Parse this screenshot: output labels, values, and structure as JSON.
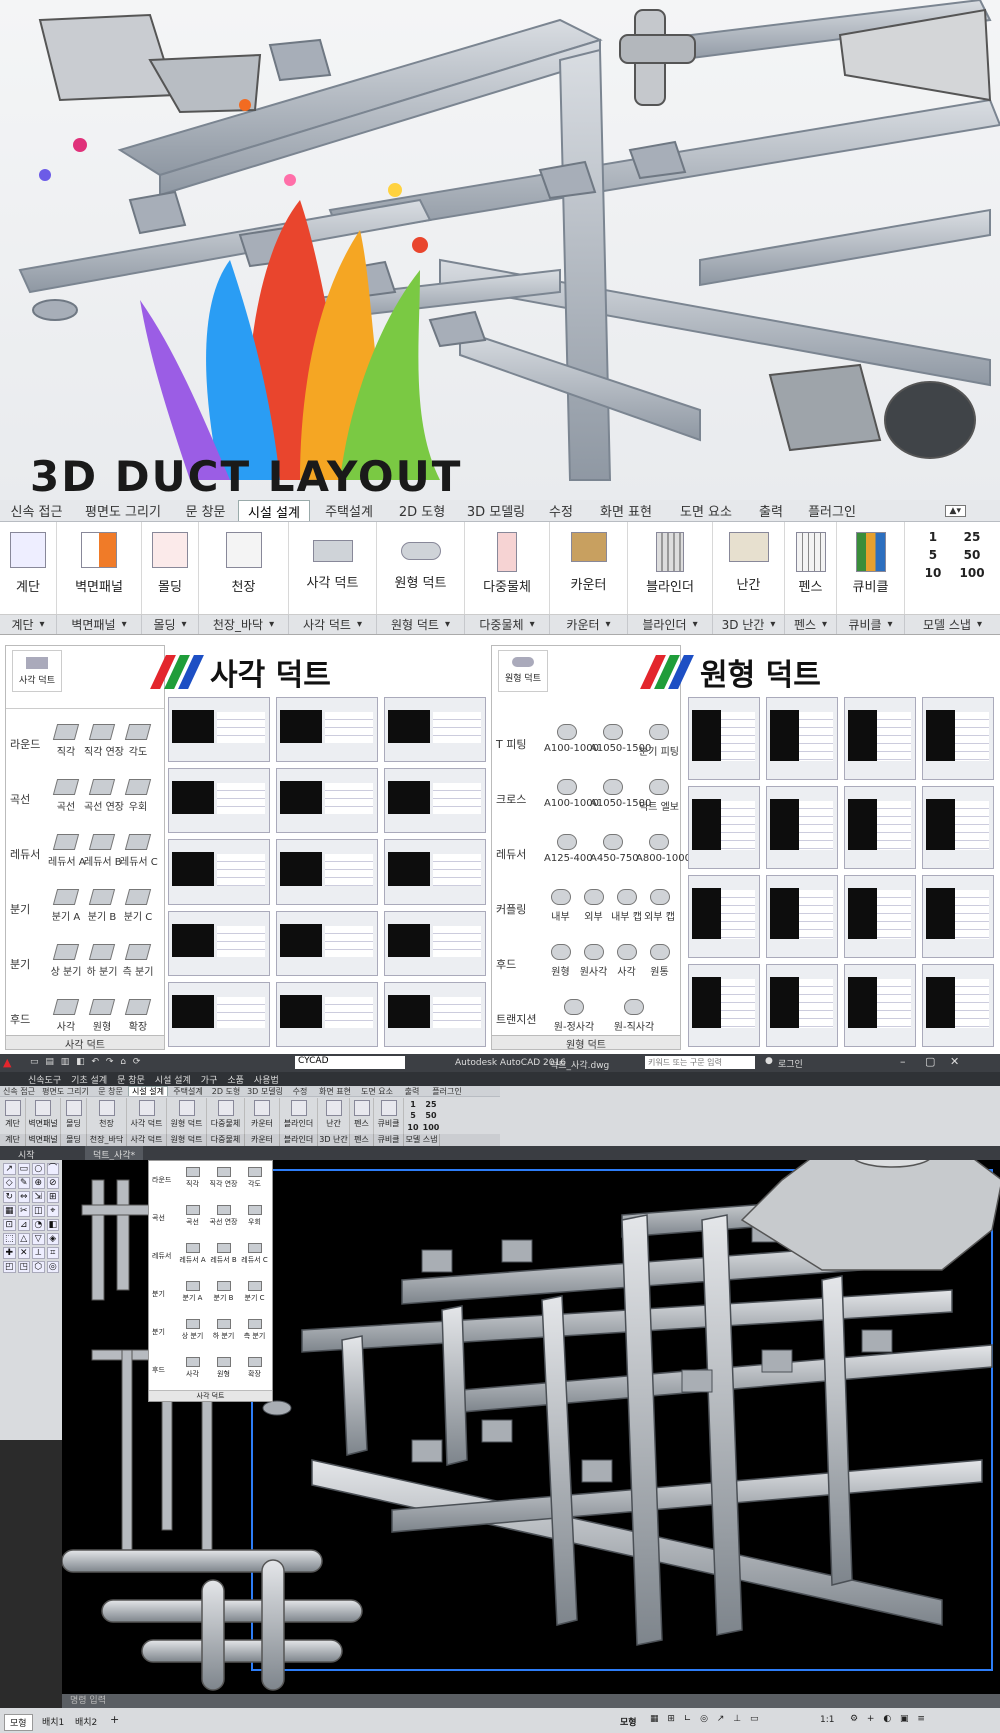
{
  "hero": {
    "title": "3D DUCT LAYOUT"
  },
  "ribbon": {
    "tabs": [
      "신속 접근",
      "평면도 그리기",
      "문 창문",
      "시설 설계",
      "주택설계",
      "2D 도형",
      "3D 모델링",
      "수정",
      "화면 표현",
      "도면 요소",
      "출력",
      "플러그인"
    ],
    "active_tab": "시설 설계",
    "tools": [
      "계단",
      "벽면패널",
      "몰딩",
      "천장",
      "사각 덕트",
      "원형 덕트",
      "다중물체",
      "카운터",
      "블라인더",
      "난간",
      "펜스",
      "큐비클"
    ],
    "snap_values": [
      "1",
      "25",
      "5",
      "50",
      "10",
      "100"
    ],
    "groups": [
      "계단",
      "벽면패널",
      "몰딩",
      "천장_바닥",
      "사각 덕트",
      "원형 덕트",
      "다중물체",
      "카운터",
      "블라인더",
      "3D 난간",
      "펜스",
      "큐비클",
      "모델 스냅"
    ]
  },
  "square_palette": {
    "icon_label": "사각 덕트",
    "heading": "사각 덕트",
    "footer": "사각 덕트",
    "rows": [
      {
        "category": "라운드",
        "items": [
          "직각",
          "직각 연장",
          "각도"
        ]
      },
      {
        "category": "곡선",
        "items": [
          "곡선",
          "곡선 연장",
          "우회"
        ]
      },
      {
        "category": "레듀서",
        "items": [
          "레듀서 A",
          "레듀서 B",
          "레듀서 C"
        ]
      },
      {
        "category": "분기",
        "items": [
          "분기 A",
          "분기 B",
          "분기 C"
        ]
      },
      {
        "category": "분기",
        "items": [
          "상 분기",
          "하 분기",
          "측 분기"
        ]
      },
      {
        "category": "후드",
        "items": [
          "사각",
          "원형",
          "확장"
        ]
      }
    ]
  },
  "round_palette": {
    "icon_label": "원형 덕트",
    "heading": "원형 덕트",
    "footer": "원형 덕트",
    "rows": [
      {
        "category": "T 피팅",
        "items": [
          "A100-1000",
          "A1050-1500",
          "분기 피팅"
        ]
      },
      {
        "category": "크로스",
        "items": [
          "A100-1000",
          "A1050-1500",
          "덕트 엘보"
        ]
      },
      {
        "category": "레듀서",
        "items": [
          "A125-400",
          "A450-750",
          "A800-1000"
        ]
      },
      {
        "category": "커플링",
        "items": [
          "내부",
          "외부",
          "내부 캡",
          "외부 캡"
        ]
      },
      {
        "category": "후드",
        "items": [
          "원형",
          "원사각",
          "사각",
          "원통"
        ]
      },
      {
        "category": "트랜지션",
        "items": [
          "원-정사각",
          "원-직사각"
        ]
      }
    ]
  },
  "autocad": {
    "window_title": "Autodesk AutoCAD 2016",
    "file_name": "덕트_사각.dwg",
    "search_placeholder": "키워드 또는 구문 입력",
    "login": "로그인",
    "layer": "CYCAD",
    "menus": [
      "신속도구",
      "기초 설계",
      "문 창문",
      "시설 설계",
      "가구",
      "소품",
      "사용법"
    ],
    "doc_tabs": [
      "시작",
      "덕트_사각*"
    ],
    "layout_tabs": [
      "모형",
      "배치1",
      "배치2"
    ],
    "command_placeholder": "명령 입력",
    "model_label": "모형",
    "scale": "1:1",
    "palette_footer": "사각 덕트"
  },
  "colors": {
    "accent": "#1e5fd6",
    "stripe_red": "#e3262d",
    "stripe_green": "#1f9d3a",
    "stripe_blue": "#1d4fc4",
    "cad_bg": "#000000",
    "cad_chrome": "#d9dbde"
  }
}
